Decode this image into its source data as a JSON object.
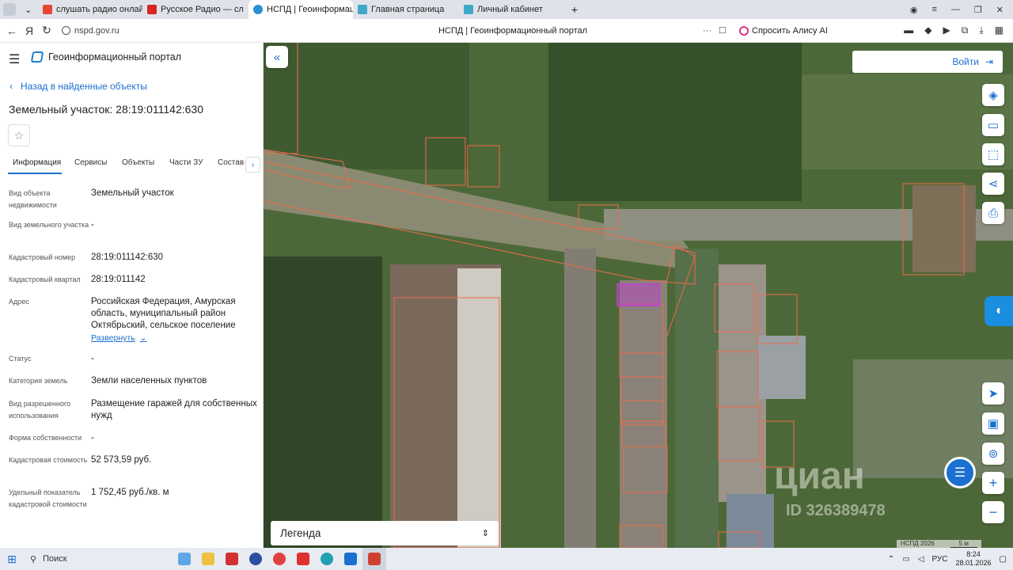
{
  "browser": {
    "tabs": [
      {
        "label": "слушать радио онлайн бе",
        "color": "#e64533"
      },
      {
        "label": "Русское Радио — сл",
        "color": "#d7261f"
      },
      {
        "label": "НСПД | Геоинформаци",
        "color": "#2b8fd6"
      },
      {
        "label": "Главная страница",
        "color": "#3fa8c8"
      },
      {
        "label": "Личный кабинет",
        "color": "#3fa8c8"
      }
    ],
    "url": "nspd.gov.ru",
    "page_title": "НСПД | Геоинформационный портал",
    "alice_label": "Спросить Алису AI"
  },
  "header": {
    "title": "Геоинформационный портал"
  },
  "nav": {
    "back_label": "Назад в найденные объекты"
  },
  "object": {
    "title": "Земельный участок: 28:19:011142:630"
  },
  "tabs": [
    "Информация",
    "Сервисы",
    "Объекты",
    "Части ЗУ",
    "Состав"
  ],
  "info": [
    {
      "label": "Вид объекта недвижимости",
      "value": "Земельный участок"
    },
    {
      "label": "Вид земельного участка",
      "value": "-"
    },
    {
      "label": "Кадастровый номер",
      "value": "28:19:011142:630"
    },
    {
      "label": "Кадастровый квартал",
      "value": "28:19:011142"
    },
    {
      "label": "Адрес",
      "value": "Российская Федерация, Амурская область, муниципальный район Октябрьский, сельское поселение"
    },
    {
      "label": "Статус",
      "value": "-"
    },
    {
      "label": "Категория земель",
      "value": "Земли населенных пунктов"
    },
    {
      "label": "Вид разрешенного использования",
      "value": "Размещение гаражей для собственных нужд"
    },
    {
      "label": "Форма собственности",
      "value": "-"
    },
    {
      "label": "Кадастровая стоимость",
      "value": "52 573,59 руб."
    },
    {
      "label": "Удельный показатель кадастровой стоимости",
      "value": "1 752,45 руб./кв. м"
    }
  ],
  "expand_label": "Развернуть",
  "map": {
    "login_label": "Войти",
    "legend_label": "Легенда",
    "copyright": "НСПД 2026",
    "scale": "5 м",
    "watermark": "циан",
    "watermark_id": "ID 326389478"
  },
  "taskbar": {
    "search_placeholder": "Поиск",
    "lang": "РУС",
    "time": "8:24",
    "date": "28.01.2026"
  }
}
